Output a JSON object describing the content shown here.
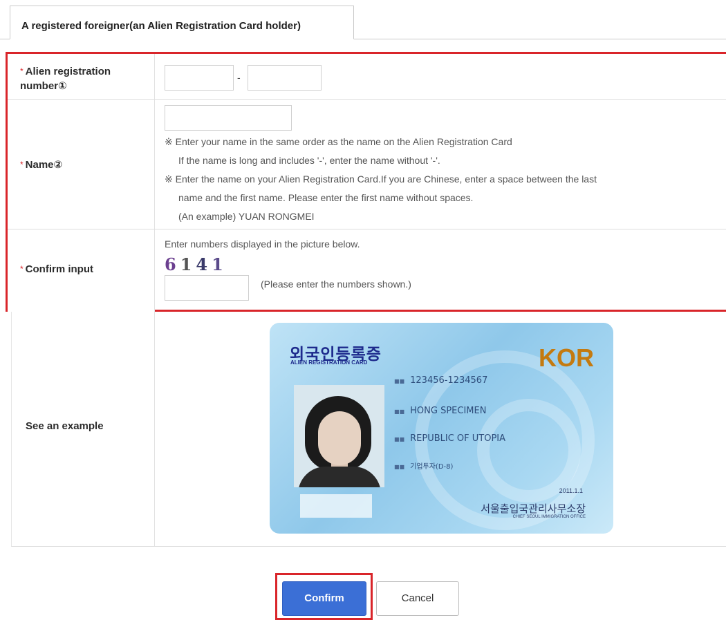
{
  "tab": {
    "label": "A registered foreigner(an Alien Registration Card holder)"
  },
  "form": {
    "alien_number": {
      "label": "Alien registration number①",
      "separator": "-",
      "value_front": "",
      "value_back": ""
    },
    "name": {
      "label": "Name②",
      "value": "",
      "notes": [
        "※ Enter your name in the same order as the name on the Alien Registration Card",
        "If the name is long and includes '-', enter the name without '-'.",
        "※ Enter the name on your Alien Registration Card.If you are Chinese, enter a space between the last",
        "name and the first name. Please enter the first name without spaces.",
        "(An example) YUAN RONGMEI"
      ]
    },
    "confirm_input": {
      "label": "Confirm input",
      "instruction": "Enter numbers displayed in the picture below.",
      "captcha": [
        "6",
        "1",
        "4",
        "1"
      ],
      "value": "",
      "hint": "(Please enter the numbers shown.)"
    },
    "example": {
      "label": "See an example",
      "card": {
        "title_ko": "외국인등록증",
        "title_en": "ALIEN REGISTRATION CARD",
        "country": "KOR",
        "number": "123456-1234567",
        "name": "HONG SPECIMEN",
        "nationality": "REPUBLIC OF UTOPIA",
        "status": "기업투자(D-8)",
        "issue_date": "2011.1.1",
        "office_ko": "서울출입국관리사무소장",
        "office_en": "CHIEF SEOUL IMMIGRATION OFFICE"
      }
    }
  },
  "buttons": {
    "confirm": "Confirm",
    "cancel": "Cancel"
  },
  "colors": {
    "highlight": "#d9252a",
    "primary": "#3b6fd6"
  }
}
